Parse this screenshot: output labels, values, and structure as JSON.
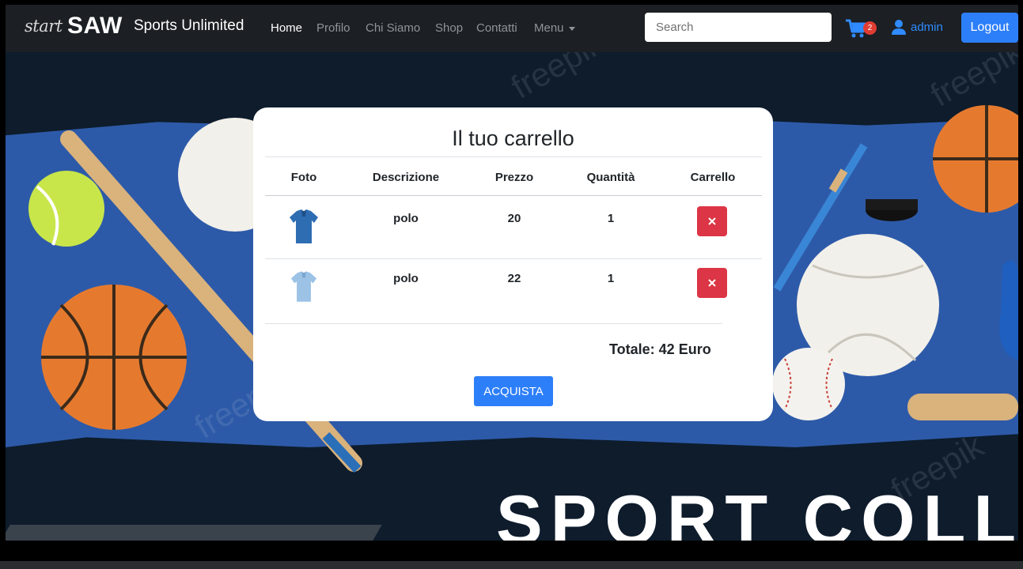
{
  "navbar": {
    "brand_script": "start",
    "brand_logo": "SAW",
    "brand_name": "Sports Unlimited",
    "links": [
      {
        "label": "Home",
        "active": true
      },
      {
        "label": "Profilo",
        "active": false
      },
      {
        "label": "Chi Siamo",
        "active": false
      },
      {
        "label": "Shop",
        "active": false
      },
      {
        "label": "Contatti",
        "active": false
      },
      {
        "label": "Menu",
        "active": false
      }
    ],
    "search_placeholder": "Search",
    "cart_icon": "shopping-cart-icon",
    "cart_count": "2",
    "user_icon": "user-icon",
    "user_label": "admin",
    "logout_label": "Logout"
  },
  "hero": {
    "banner_text": "SPORT COLLECTI"
  },
  "cart": {
    "title": "Il tuo carrello",
    "columns": [
      "Foto",
      "Descrizione",
      "Prezzo",
      "Quantità",
      "Carrello"
    ],
    "items": [
      {
        "description": "polo",
        "price": "20",
        "quantity": "1",
        "shirt_color": "#2f6db3",
        "remove_icon": "close-icon"
      },
      {
        "description": "polo",
        "price": "22",
        "quantity": "1",
        "shirt_color": "#9cc3e6",
        "remove_icon": "close-icon"
      }
    ],
    "total": "Totale: 42 Euro",
    "buy_label": "ACQUISTA"
  },
  "colors": {
    "navbar_bg": "#1c1f23",
    "accent_blue": "#2d7ff9",
    "danger_red": "#dc3545",
    "hero_bg": "#0e1c2c",
    "hero_stripe": "#2d5aa8"
  }
}
